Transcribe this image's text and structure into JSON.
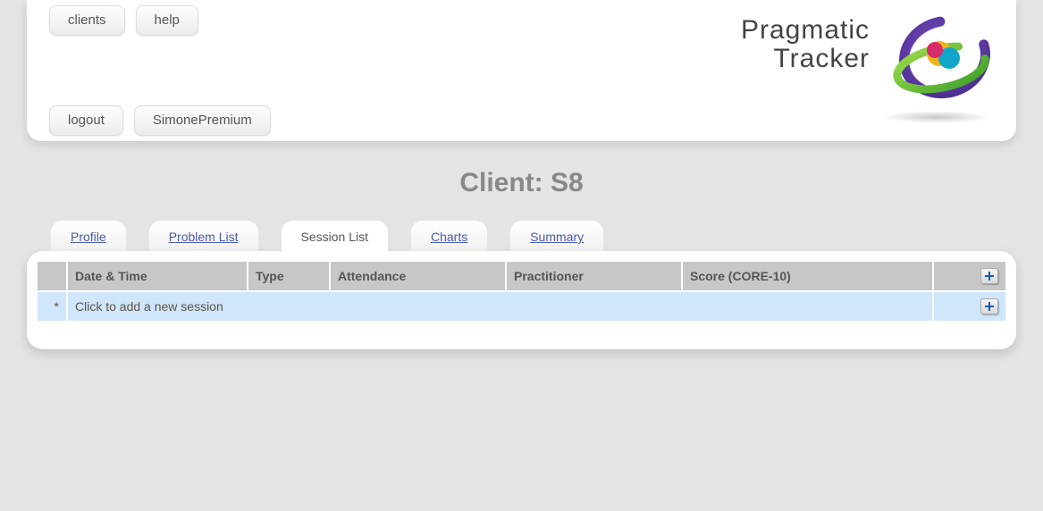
{
  "nav": {
    "top": {
      "clients": "clients",
      "help": "help"
    },
    "bottom": {
      "logout": "logout",
      "user": "SimonePremium"
    }
  },
  "brand": {
    "line1": "Pragmatic",
    "line2": "Tracker"
  },
  "page": {
    "title": "Client: S8"
  },
  "tabs": {
    "profile": "Profile",
    "problem_list": "Problem List",
    "session_list": "Session List",
    "charts": "Charts",
    "summary": "Summary",
    "active": "session_list"
  },
  "table": {
    "columns": {
      "marker": "",
      "datetime": "Date & Time",
      "type": "Type",
      "attendance": "Attendance",
      "practitioner": "Practitioner",
      "score": "Score (CORE-10)",
      "actions": ""
    },
    "new_row": {
      "marker": "*",
      "hint": "Click to add a new session"
    }
  }
}
